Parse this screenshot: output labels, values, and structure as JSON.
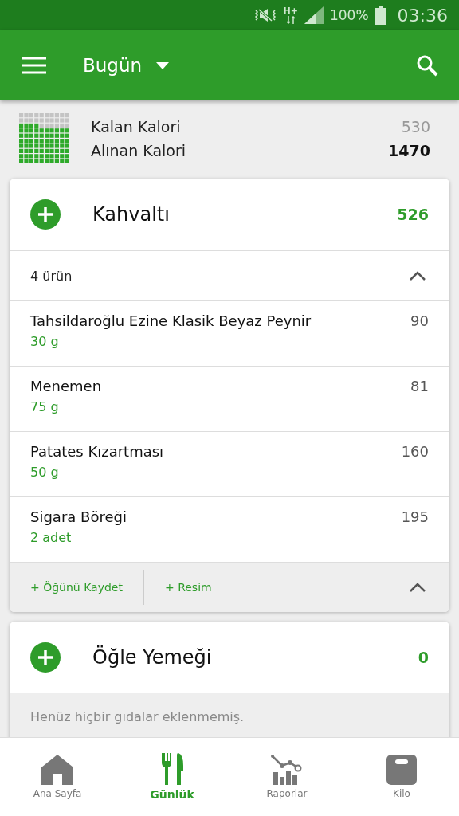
{
  "status_bar": {
    "network": "H+",
    "battery": "100%",
    "time": "03:36"
  },
  "app_bar": {
    "title": "Bugün"
  },
  "summary": {
    "rows": [
      {
        "label": "Kalan Kalori",
        "value": "530",
        "kind": "remaining"
      },
      {
        "label": "Alınan Kalori",
        "value": "1470",
        "kind": "taken"
      }
    ]
  },
  "meals": [
    {
      "name": "Kahvaltı",
      "calories": "526",
      "expanded": true,
      "count": "4 ürün",
      "items": [
        {
          "name": "Tahsildaroğlu Ezine Klasik Beyaz Peynir",
          "amount": "30 g",
          "calories": "90"
        },
        {
          "name": "Menemen",
          "amount": "75 g",
          "calories": "81"
        },
        {
          "name": "Patates Kızartması",
          "amount": "50 g",
          "calories": "160"
        },
        {
          "name": "Sigara Böreği",
          "amount": "2  adet",
          "calories": "195"
        }
      ],
      "actions": [
        "+ Öğünü Kaydet",
        "+ Resim"
      ]
    },
    {
      "name": "Öğle Yemeği",
      "calories": "0",
      "expanded": false,
      "empty_text": "Henüz hiçbir gıdalar eklenmemiş."
    }
  ],
  "bottom_nav": [
    {
      "label": "Ana Sayfa",
      "kind": "home",
      "selected": false
    },
    {
      "label": "Günlük",
      "kind": "diary",
      "selected": true
    },
    {
      "label": "Raporlar",
      "kind": "reports",
      "selected": false
    },
    {
      "label": "Kilo",
      "kind": "weight",
      "selected": false
    }
  ]
}
